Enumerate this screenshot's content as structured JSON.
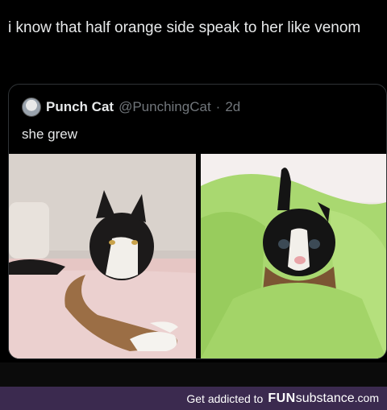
{
  "post": {
    "caption": "i know that half orange side speak to her like venom"
  },
  "quote": {
    "display_name": "Punch Cat",
    "handle": "@PunchingCat",
    "separator": "·",
    "time": "2d",
    "text": "she grew",
    "avatar_icon": "cat-avatar-icon",
    "images": [
      {
        "name": "adult-cat-photo",
        "alt_subject": "adult calico cat lying on bed"
      },
      {
        "name": "kitten-photo",
        "alt_subject": "kitten wrapped in green towel"
      }
    ]
  },
  "footer": {
    "prefix": "Get addicted to",
    "brand_fun": "FUN",
    "brand_sub": "substance",
    "brand_dom": ".com",
    "bg_color": "#3b2a4f"
  }
}
